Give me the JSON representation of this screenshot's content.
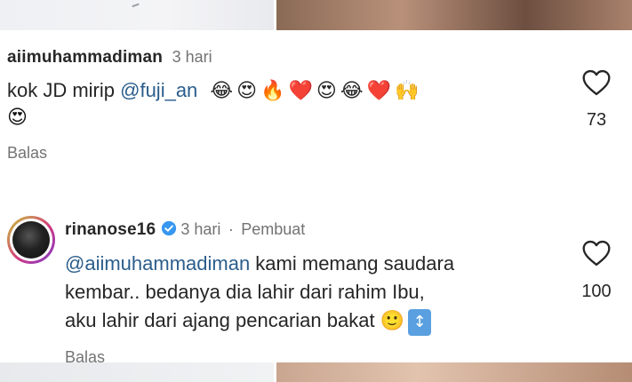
{
  "comments": [
    {
      "username": "aiimuhammadiman",
      "time": "3 hari",
      "text_prefix": "kok JD mirip ",
      "mention": "@fuji_an",
      "emojis_line1": [
        "😂",
        "😍",
        "🔥",
        "❤️",
        "😍",
        "😂",
        "❤️",
        "🙌"
      ],
      "emojis_line2": [
        "😍"
      ],
      "likes": "73",
      "reply_label": "Balas"
    },
    {
      "username": "rinanose16",
      "time": "3 hari",
      "separator": "·",
      "creator_label": "Pembuat",
      "mention": "@aiimuhammadiman",
      "line1_suffix": " kami memang saudara",
      "line2": "kembar.. bedanya dia lahir dari rahim Ibu,",
      "line3": "aku lahir dari ajang pencarian bakat ",
      "emojis_line3": [
        "🙂",
        "↕"
      ],
      "likes": "100",
      "reply_label": "Balas"
    }
  ],
  "colors": {
    "mention": "#2b5d8c",
    "verified": "#3797f0",
    "secondary_text": "#737373"
  }
}
